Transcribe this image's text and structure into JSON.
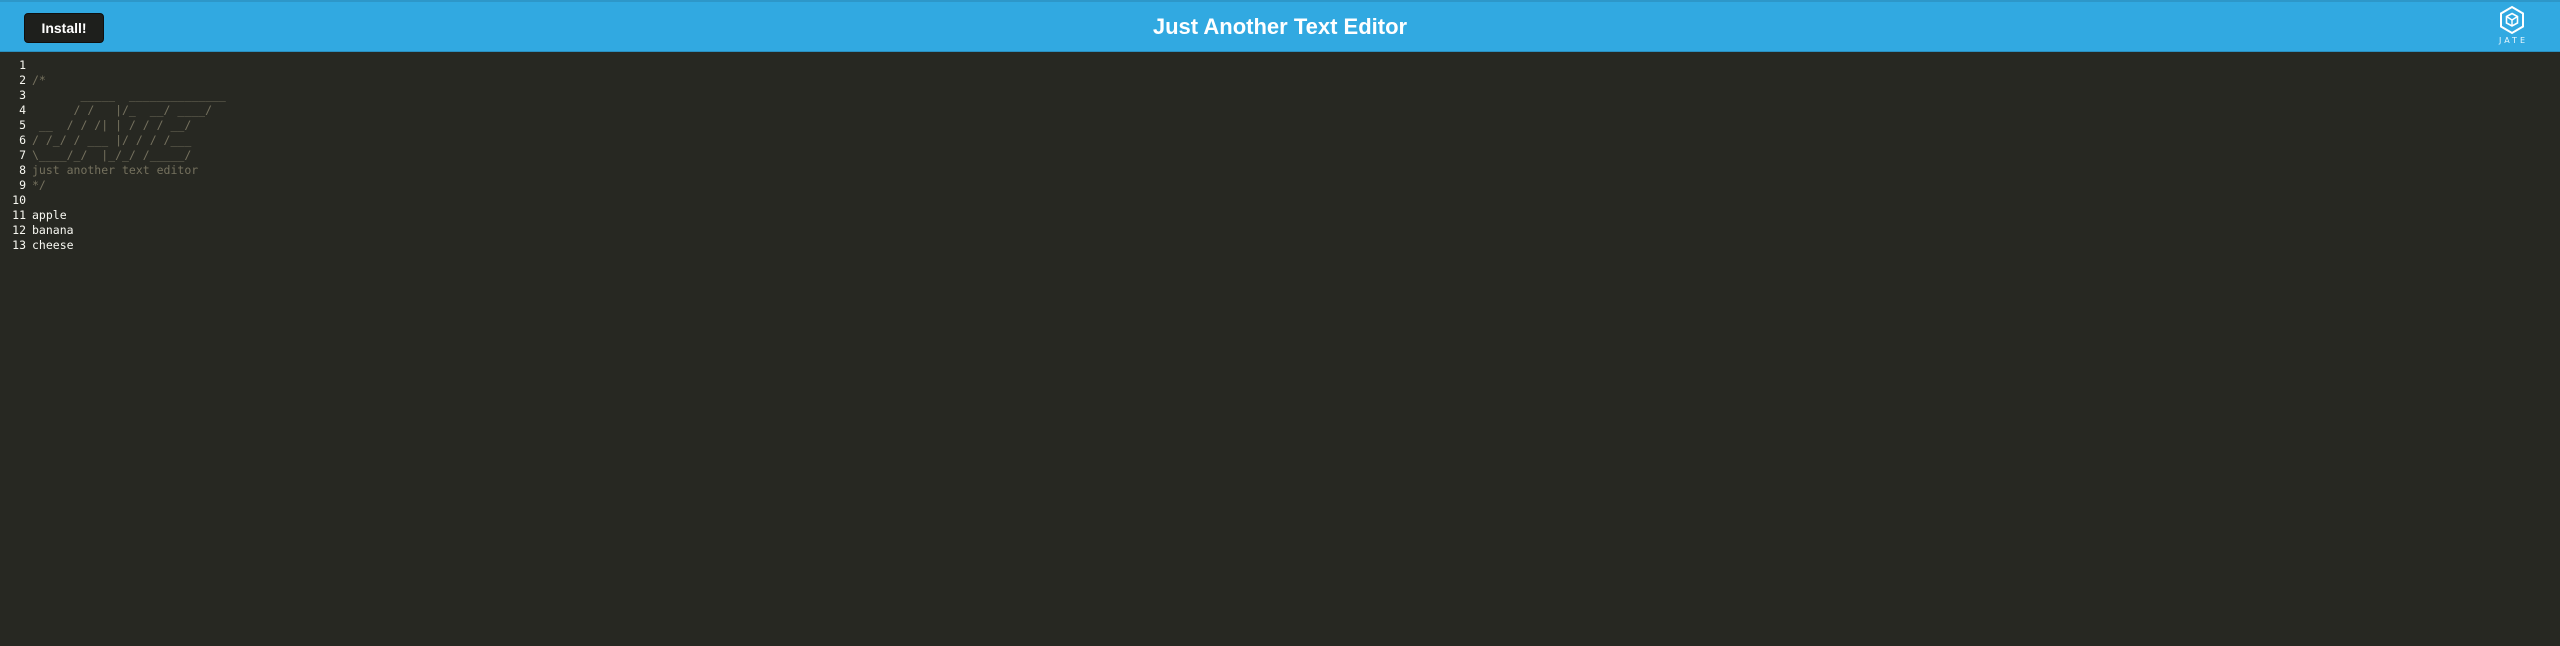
{
  "navbar": {
    "install_label": "Install!",
    "title": "Just Another Text Editor",
    "logo_text": "JATE",
    "background_color": "#31a9e1",
    "button_color": "#1e1f1c"
  },
  "editor": {
    "background_color": "#272822",
    "comment_color": "#75715e",
    "text_color": "#f8f8f2",
    "lines": [
      {
        "number": "1",
        "text": "",
        "kind": "text"
      },
      {
        "number": "2",
        "text": "/*",
        "kind": "comment"
      },
      {
        "number": "3",
        "text": "       _____  ______________",
        "kind": "comment"
      },
      {
        "number": "4",
        "text": "      / /   |/_  __/ ____/",
        "kind": "comment"
      },
      {
        "number": "5",
        "text": " __  / / /| | / / / __/",
        "kind": "comment"
      },
      {
        "number": "6",
        "text": "/ /_/ / ___ |/ / / /___",
        "kind": "comment"
      },
      {
        "number": "7",
        "text": "\\____/_/  |_/_/ /_____/",
        "kind": "comment"
      },
      {
        "number": "8",
        "text": "just another text editor",
        "kind": "comment"
      },
      {
        "number": "9",
        "text": "*/",
        "kind": "comment"
      },
      {
        "number": "10",
        "text": "",
        "kind": "text"
      },
      {
        "number": "11",
        "text": "apple",
        "kind": "text"
      },
      {
        "number": "12",
        "text": "banana",
        "kind": "text"
      },
      {
        "number": "13",
        "text": "cheese",
        "kind": "text"
      }
    ]
  }
}
